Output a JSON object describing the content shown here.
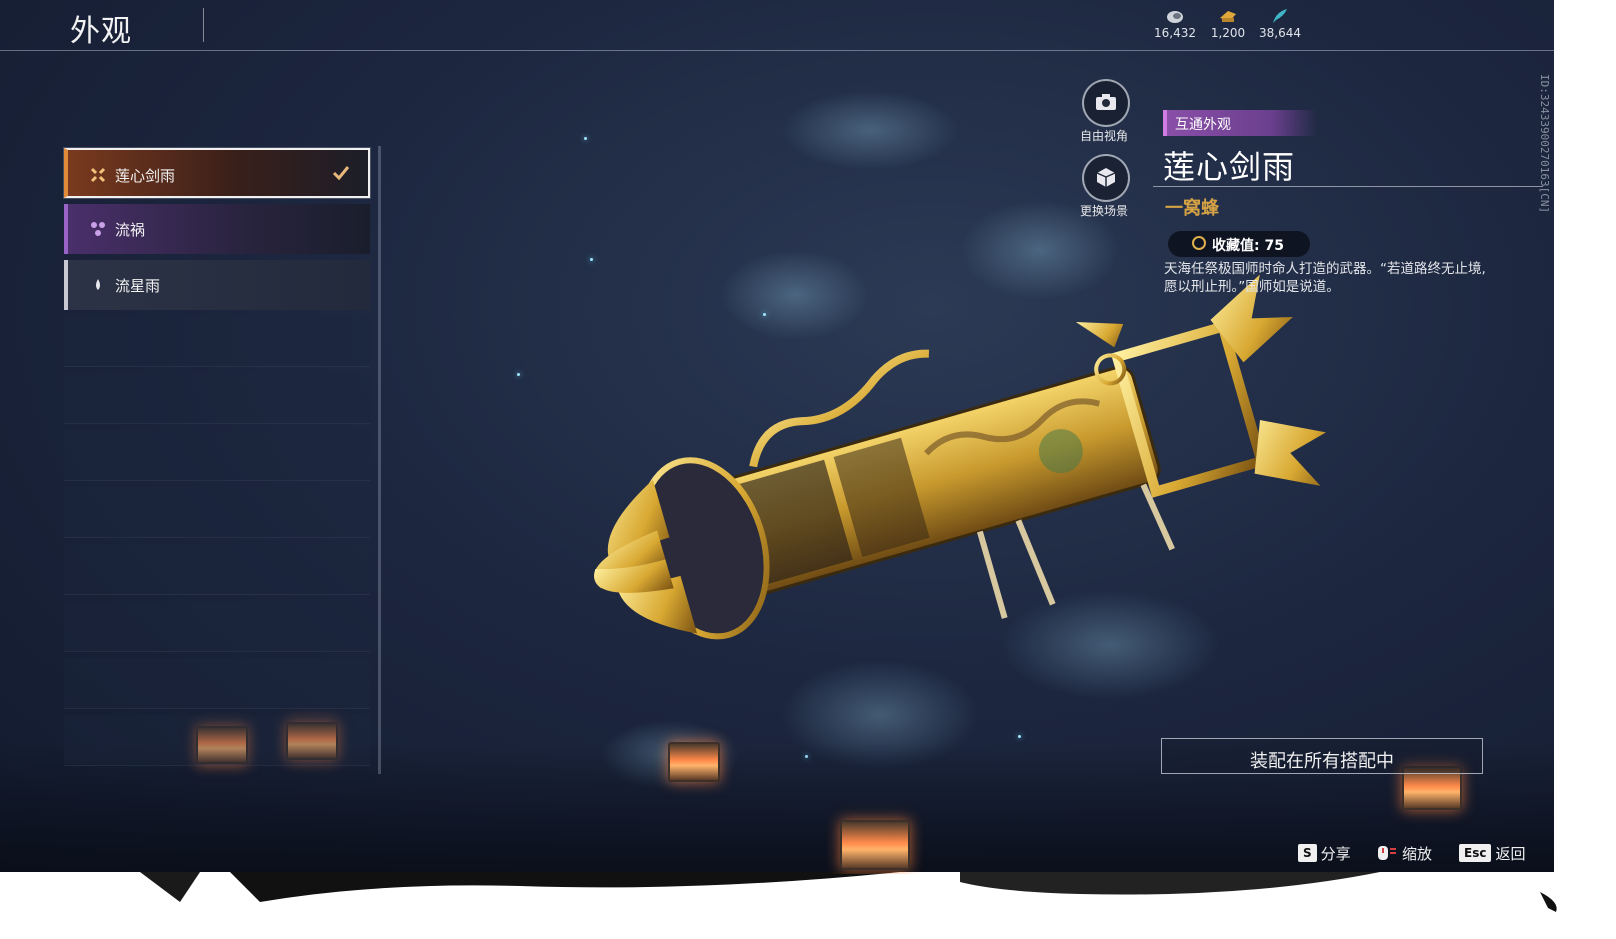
{
  "header": {
    "title": "外观",
    "currencies": [
      {
        "icon": "coin-icon",
        "value": "16,432"
      },
      {
        "icon": "ticket-icon",
        "value": "1,200"
      },
      {
        "icon": "feather-icon",
        "value": "38,644"
      }
    ]
  },
  "list": {
    "items": [
      {
        "label": "莲心剑雨",
        "icon": "lotus-icon",
        "selected": true,
        "color": "#e08a3a"
      },
      {
        "label": "流祸",
        "icon": "trefoil-icon",
        "selected": false,
        "color": "#9a63c8"
      },
      {
        "label": "流星雨",
        "icon": "drop-icon",
        "selected": false,
        "color": "#c8c8d2"
      }
    ]
  },
  "view_buttons": {
    "free_camera": "自由视角",
    "change_scene": "更换场景"
  },
  "detail": {
    "tag": "互通外观",
    "name": "莲心剑雨",
    "subtitle": "一窝蜂",
    "collection": "收藏值: 75",
    "description": "天海任祭极国师时命人打造的武器。“若道路终无止境,愿以刑止刑。”国师如是说道。",
    "equip_button": "装配在所有搭配中"
  },
  "side_id": "ID:3243390027016З[CN]",
  "hints": [
    {
      "key": "S",
      "label": "分享"
    },
    {
      "key": "",
      "label": "缩放"
    },
    {
      "key": "Esc",
      "label": "返回"
    }
  ],
  "colors": {
    "accent_gold": "#d4a245",
    "tag_purple": "#8a4fa8",
    "selected_orange": "#e08a3a"
  }
}
